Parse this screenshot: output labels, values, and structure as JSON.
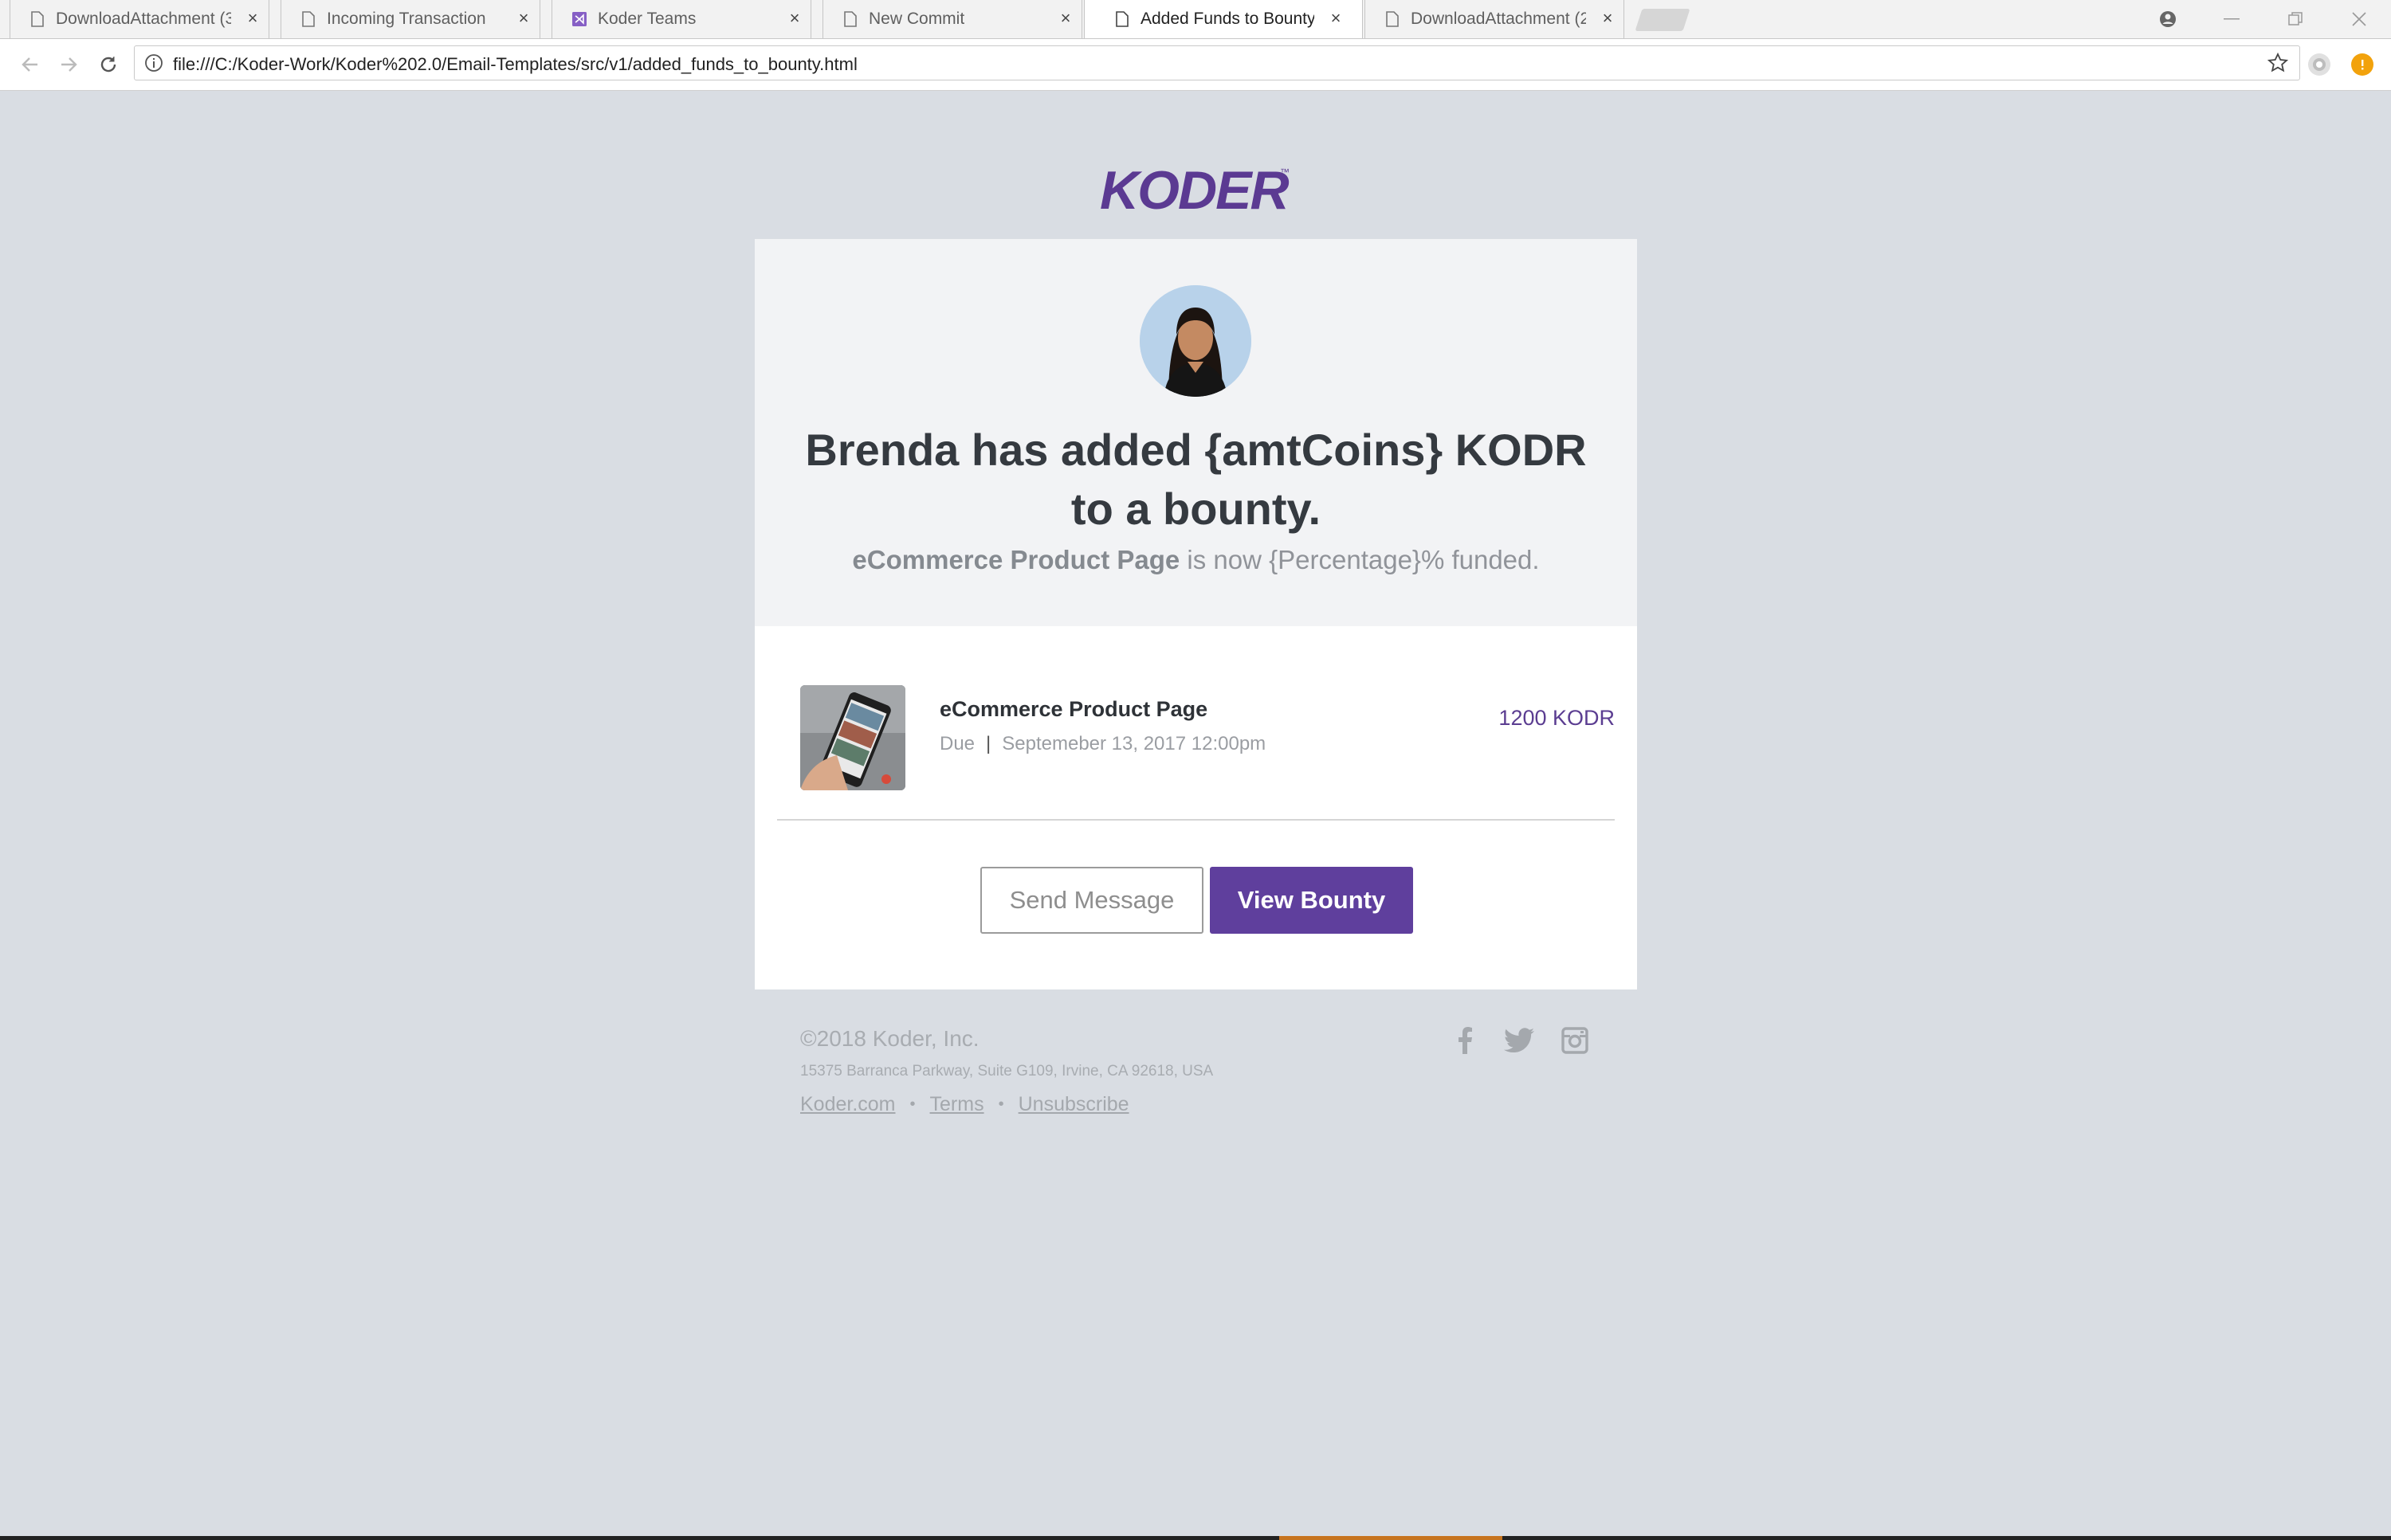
{
  "browser": {
    "tabs": [
      {
        "title": "DownloadAttachment (3",
        "icon": "document-icon",
        "active": false
      },
      {
        "title": "Incoming Transaction",
        "icon": "document-icon",
        "active": false
      },
      {
        "title": "Koder Teams",
        "icon": "visual-studio-icon",
        "active": false
      },
      {
        "title": "New Commit",
        "icon": "document-icon",
        "active": false
      },
      {
        "title": "Added Funds to Bounty",
        "icon": "document-icon",
        "active": true
      },
      {
        "title": "DownloadAttachment (2",
        "icon": "document-icon",
        "active": false
      }
    ],
    "address_bar": {
      "url": "file:///C:/Koder-Work/Koder%202.0/Email-Templates/src/v1/added_funds_to_bounty.html"
    }
  },
  "email": {
    "logo_text": "KODER",
    "headline": "Brenda has added {amtCoins} KODR to a bounty.",
    "subline": {
      "project": "eCommerce Product Page",
      "rest": " is now {Percentage}% funded."
    },
    "bounty": {
      "title": "eCommerce Product Page",
      "due_label": "Due",
      "due_separator": "|",
      "due_date": "Septemeber 13, 2017 12:00pm",
      "amount": "1200 KODR"
    },
    "buttons": {
      "send_message": "Send Message",
      "view_bounty": "View Bounty"
    },
    "footer": {
      "copyright": "©2018 Koder, Inc.",
      "address": "15375 Barranca Parkway, Suite G109, Irvine, CA 92618, USA",
      "links": [
        "Koder.com",
        "Terms",
        "Unsubscribe"
      ],
      "link_separator": "•",
      "social": [
        "facebook-icon",
        "twitter-icon",
        "instagram-icon"
      ]
    }
  },
  "colors": {
    "page_background": "#d9dde3",
    "brand_purple": "#5f3f9d",
    "card_header": "#f2f3f5"
  }
}
